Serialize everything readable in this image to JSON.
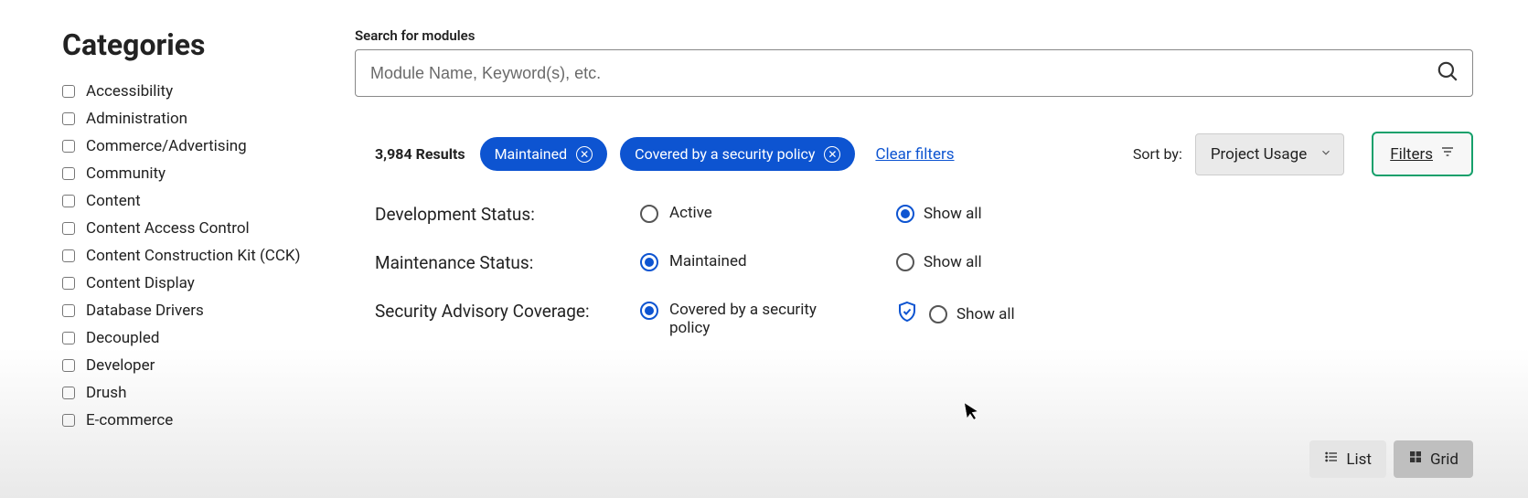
{
  "sidebar": {
    "title": "Categories",
    "items": [
      {
        "label": "Accessibility"
      },
      {
        "label": "Administration"
      },
      {
        "label": "Commerce/Advertising"
      },
      {
        "label": "Community"
      },
      {
        "label": "Content"
      },
      {
        "label": "Content Access Control"
      },
      {
        "label": "Content Construction Kit (CCK)"
      },
      {
        "label": "Content Display"
      },
      {
        "label": "Database Drivers"
      },
      {
        "label": "Decoupled"
      },
      {
        "label": "Developer"
      },
      {
        "label": "Drush"
      },
      {
        "label": "E-commerce"
      }
    ]
  },
  "search": {
    "label": "Search for modules",
    "placeholder": "Module Name, Keyword(s), etc."
  },
  "results": {
    "count_text": "3,984 Results"
  },
  "chips": [
    {
      "label": "Maintained"
    },
    {
      "label": "Covered by a security policy"
    }
  ],
  "clear_filters_label": "Clear filters",
  "sort": {
    "label": "Sort by:",
    "selected": "Project Usage"
  },
  "filters_button": "Filters",
  "filter_sections": {
    "dev_status": {
      "label": "Development Status:",
      "optA": "Active",
      "optB": "Show all",
      "selected": "B"
    },
    "maint_status": {
      "label": "Maintenance Status:",
      "optA": "Maintained",
      "optB": "Show all",
      "selected": "A"
    },
    "security": {
      "label": "Security Advisory Coverage:",
      "optA": "Covered by a security policy",
      "optB": "Show all",
      "selected": "A"
    }
  },
  "view": {
    "list": "List",
    "grid": "Grid"
  }
}
